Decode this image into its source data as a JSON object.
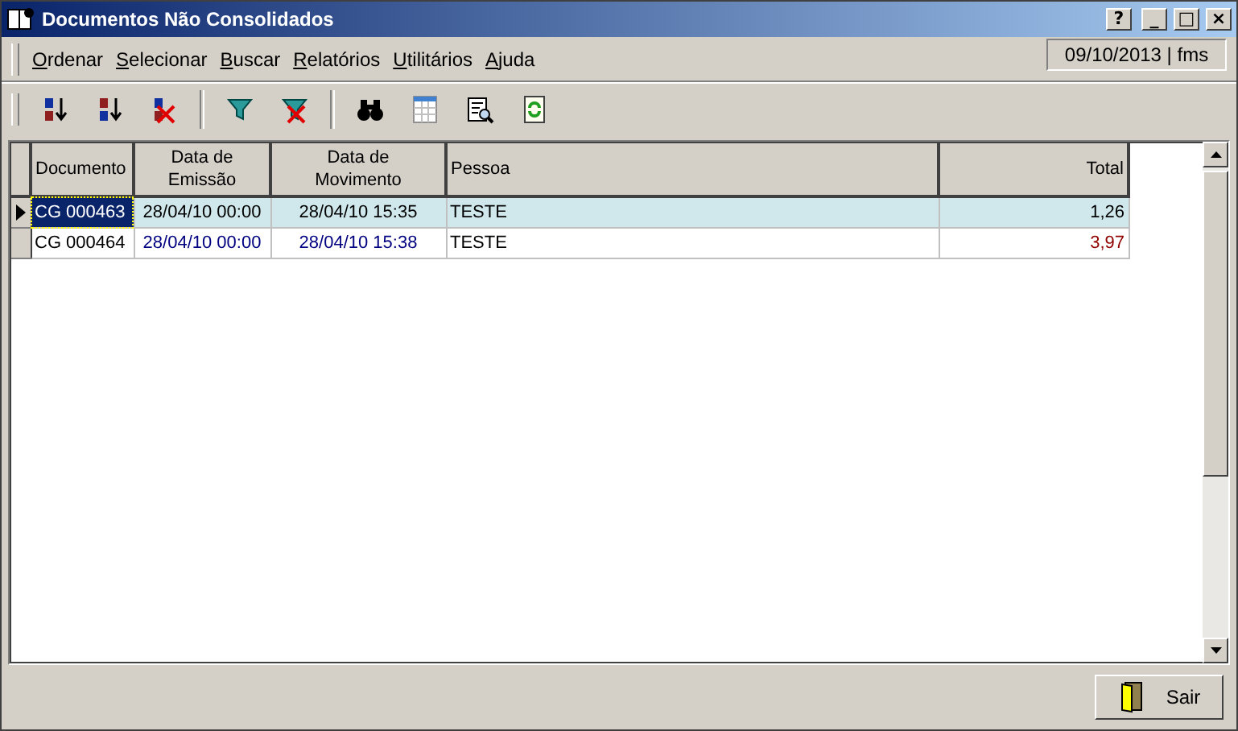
{
  "window": {
    "title": "Documentos Não Consolidados",
    "buttons": [
      "?",
      "_",
      "□",
      "×"
    ]
  },
  "menu": [
    {
      "label": "Ordenar"
    },
    {
      "label": "Selecionar"
    },
    {
      "label": "Buscar"
    },
    {
      "label": "Relatórios"
    },
    {
      "label": "Utilitários"
    },
    {
      "label": "Ajuda"
    }
  ],
  "status": "09/10/2013 | fms",
  "table": {
    "columns": [
      {
        "label": "Documento"
      },
      {
        "label": "Data de Emissão"
      },
      {
        "label": "Data de Movimento"
      },
      {
        "label": "Pessoa"
      },
      {
        "label": "Total"
      }
    ],
    "rows": [
      {
        "selected": true,
        "cells": [
          "CG 000463",
          "28/04/10 00:00",
          "28/04/10 15:35",
          "TESTE",
          "1,26"
        ]
      },
      {
        "selected": false,
        "cells": [
          "CG 000464",
          "28/04/10 00:00",
          "28/04/10 15:38",
          "TESTE",
          "3,97"
        ]
      }
    ]
  },
  "exit_button": "Sair"
}
